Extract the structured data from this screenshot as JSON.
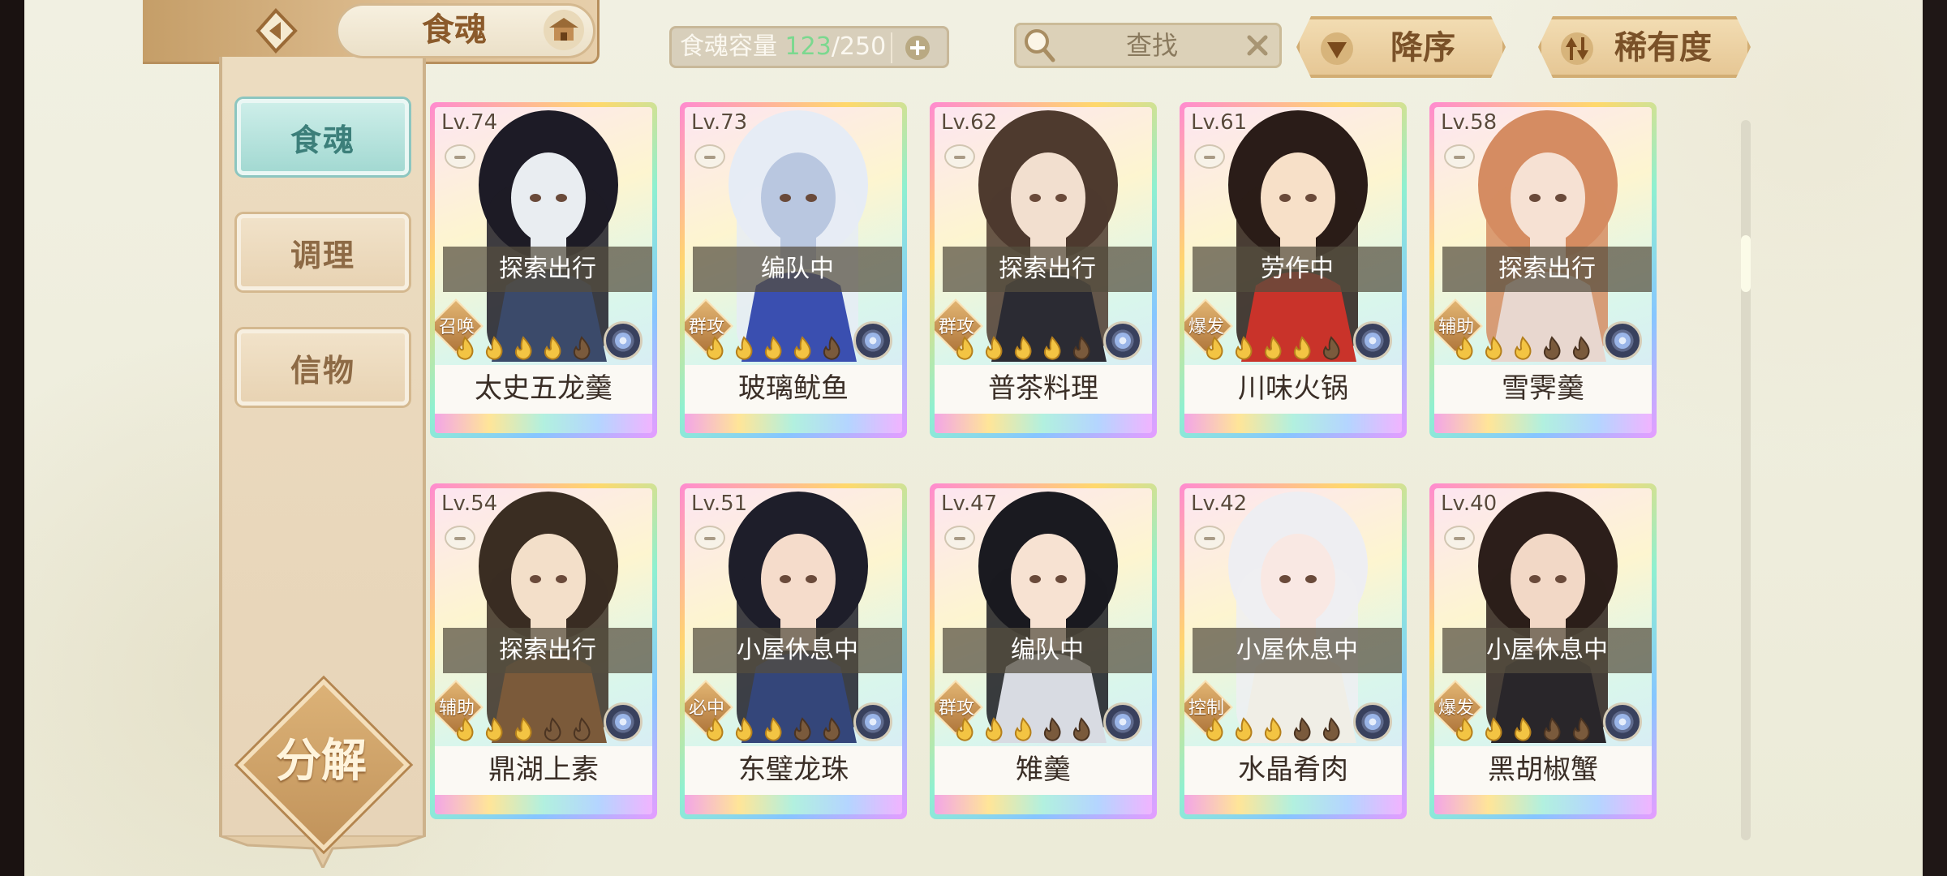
{
  "header": {
    "title": "食魂",
    "capacity_label": "食魂容量",
    "capacity_current": "123",
    "capacity_max": "/250"
  },
  "search": {
    "label": "查找"
  },
  "sort": {
    "order_label": "降序",
    "key_label": "稀有度"
  },
  "nav": {
    "items": [
      {
        "label": "食魂",
        "active": true
      },
      {
        "label": "调理",
        "active": false
      },
      {
        "label": "信物",
        "active": false
      }
    ],
    "decompose_label": "分解"
  },
  "cards": [
    {
      "level": "Lv.74",
      "status": "探索出行",
      "role": "召唤",
      "name": "太史五龙羹",
      "stars": 4
    },
    {
      "level": "Lv.73",
      "status": "编队中",
      "role": "群攻",
      "name": "玻璃鱿鱼",
      "stars": 4
    },
    {
      "level": "Lv.62",
      "status": "探索出行",
      "role": "群攻",
      "name": "普茶料理",
      "stars": 4
    },
    {
      "level": "Lv.61",
      "status": "劳作中",
      "role": "爆发",
      "name": "川味火锅",
      "stars": 4
    },
    {
      "level": "Lv.58",
      "status": "探索出行",
      "role": "辅助",
      "name": "雪霁羹",
      "stars": 3
    },
    {
      "level": "Lv.54",
      "status": "探索出行",
      "role": "辅助",
      "name": "鼎湖上素",
      "stars": 3
    },
    {
      "level": "Lv.51",
      "status": "小屋休息中",
      "role": "必中",
      "name": "东璧龙珠",
      "stars": 3
    },
    {
      "level": "Lv.47",
      "status": "编队中",
      "role": "群攻",
      "name": "雉羹",
      "stars": 3
    },
    {
      "level": "Lv.42",
      "status": "小屋休息中",
      "role": "控制",
      "name": "水晶肴肉",
      "stars": 3
    },
    {
      "level": "Lv.40",
      "status": "小屋休息中",
      "role": "爆发",
      "name": "黑胡椒蟹",
      "stars": 3
    }
  ],
  "colors": {
    "capacity_current": "#7bd88f",
    "nav_active": "#a3d9d2",
    "gold": "#e6b33a"
  }
}
